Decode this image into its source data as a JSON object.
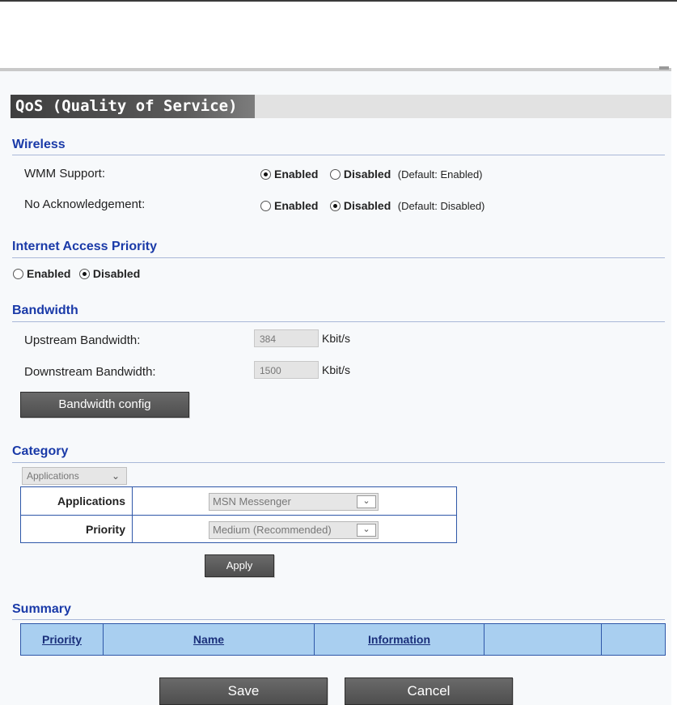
{
  "page": {
    "title": "QoS (Quality of Service)"
  },
  "wireless": {
    "heading": "Wireless",
    "rows": [
      {
        "label": "WMM Support:",
        "enabled_label": "Enabled",
        "disabled_label": "Disabled",
        "selected": "enabled",
        "default_note": "(Default: Enabled)"
      },
      {
        "label": "No Acknowledgement:",
        "enabled_label": "Enabled",
        "disabled_label": "Disabled",
        "selected": "disabled",
        "default_note": "(Default: Disabled)"
      }
    ]
  },
  "internet_access_priority": {
    "heading": "Internet Access Priority",
    "enabled_label": "Enabled",
    "disabled_label": "Disabled",
    "selected": "disabled"
  },
  "bandwidth": {
    "heading": "Bandwidth",
    "upstream_label": "Upstream Bandwidth:",
    "upstream_value": "384",
    "downstream_label": "Downstream Bandwidth:",
    "downstream_value": "1500",
    "unit": "Kbit/s",
    "config_button": "Bandwidth config"
  },
  "category": {
    "heading": "Category",
    "type_select": "Applications",
    "applications_label": "Applications",
    "applications_value": "MSN Messenger",
    "priority_label": "Priority",
    "priority_value": "Medium (Recommended)",
    "apply_button": "Apply"
  },
  "summary": {
    "heading": "Summary",
    "columns": [
      "Priority",
      "Name",
      "Information",
      "",
      ""
    ]
  },
  "footer": {
    "save_button": "Save",
    "cancel_button": "Cancel"
  },
  "icons": {
    "dropdown": "chevron-down-icon"
  }
}
